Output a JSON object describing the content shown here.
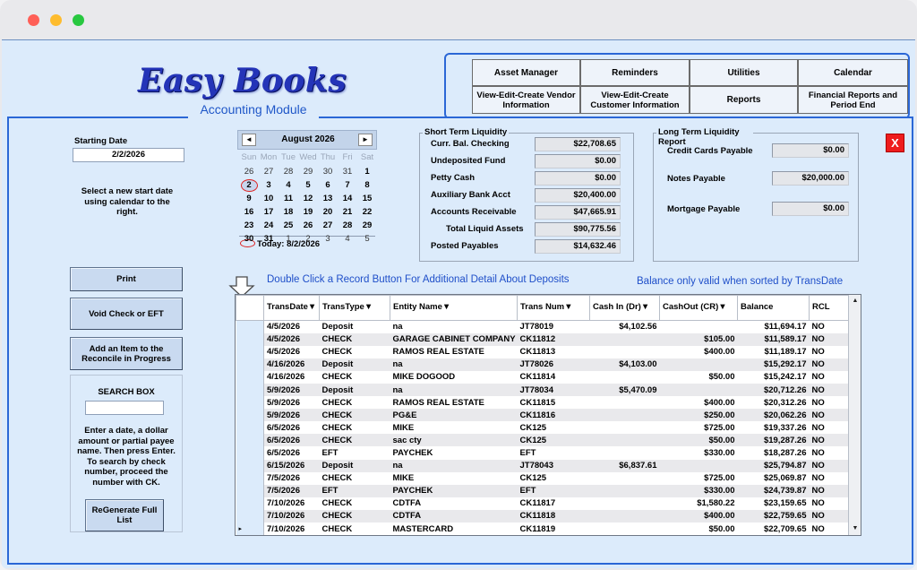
{
  "app": {
    "logo": "Easy Books",
    "module_title": "Accounting Module",
    "close_label": "X"
  },
  "nav": {
    "items": [
      {
        "label": "Asset Manager"
      },
      {
        "label": "Reminders"
      },
      {
        "label": "Utilities"
      },
      {
        "label": "Calendar"
      },
      {
        "label": "View-Edit-Create Vendor Information"
      },
      {
        "label": "View-Edit-Create Customer Information"
      },
      {
        "label": "Reports"
      },
      {
        "label": "Financial Reports and Period End"
      }
    ]
  },
  "start": {
    "label": "Starting Date",
    "value": "2/2/2026",
    "hint": "Select a new start date using calendar to the right."
  },
  "calendar": {
    "month": "August 2026",
    "prev_icon": "◄",
    "next_icon": "►",
    "weekdays": [
      "Sun",
      "Mon",
      "Tue",
      "Wed",
      "Thu",
      "Fri",
      "Sat"
    ],
    "days": [
      {
        "d": "26",
        "m": true
      },
      {
        "d": "27",
        "m": true
      },
      {
        "d": "28",
        "m": true
      },
      {
        "d": "29",
        "m": true
      },
      {
        "d": "30",
        "m": true
      },
      {
        "d": "31",
        "m": true
      },
      {
        "d": "1"
      },
      {
        "d": "2",
        "sel": true
      },
      {
        "d": "3"
      },
      {
        "d": "4"
      },
      {
        "d": "5"
      },
      {
        "d": "6"
      },
      {
        "d": "7"
      },
      {
        "d": "8"
      },
      {
        "d": "9"
      },
      {
        "d": "10"
      },
      {
        "d": "11"
      },
      {
        "d": "12"
      },
      {
        "d": "13"
      },
      {
        "d": "14"
      },
      {
        "d": "15"
      },
      {
        "d": "16"
      },
      {
        "d": "17"
      },
      {
        "d": "18"
      },
      {
        "d": "19"
      },
      {
        "d": "20"
      },
      {
        "d": "21"
      },
      {
        "d": "22"
      },
      {
        "d": "23"
      },
      {
        "d": "24"
      },
      {
        "d": "25"
      },
      {
        "d": "26"
      },
      {
        "d": "27"
      },
      {
        "d": "28"
      },
      {
        "d": "29"
      },
      {
        "d": "30"
      },
      {
        "d": "31"
      },
      {
        "d": "1",
        "m": true
      },
      {
        "d": "2",
        "m": true
      },
      {
        "d": "3",
        "m": true
      },
      {
        "d": "4",
        "m": true
      },
      {
        "d": "5",
        "m": true
      }
    ],
    "today_label": "Today: 8/2/2026"
  },
  "short_term": {
    "title": "Short Term Liquidity",
    "rows": [
      {
        "label": "Curr. Bal. Checking",
        "value": "$22,708.65"
      },
      {
        "label": "Undeposited Fund",
        "value": "$0.00"
      },
      {
        "label": "Petty Cash",
        "value": "$0.00"
      },
      {
        "label": "Auxiliary Bank Acct",
        "value": "$20,400.00"
      },
      {
        "label": "Accounts Receivable",
        "value": "$47,665.91"
      },
      {
        "label": "Total Liquid Assets",
        "value": "$90,775.56"
      },
      {
        "label": "Posted Payables",
        "value": "$14,632.46"
      }
    ]
  },
  "long_term": {
    "title": "Long Term Liquidity Report",
    "rows": [
      {
        "label": "Credit Cards Payable",
        "value": "$0.00"
      },
      {
        "label": "Notes Payable",
        "value": "$20,000.00"
      },
      {
        "label": "Mortgage Payable",
        "value": "$0.00"
      }
    ]
  },
  "buttons": {
    "print": "Print",
    "void": "Void Check or EFT",
    "add_item": "Add an Item to the Reconcile in Progress",
    "regenerate": "ReGenerate Full List"
  },
  "search": {
    "title": "SEARCH BOX",
    "value": "",
    "hint": "Enter a date, a dollar amount or partial payee name. Then press Enter. To search by check number, proceed the number with CK."
  },
  "messages": {
    "double_click": "Double Click a Record Button For Additional Detail About Deposits",
    "balance_note": "Balance only valid when sorted by TransDate"
  },
  "table": {
    "headers": [
      "TransDate▼",
      "TransType▼",
      "Entity Name▼",
      "Trans Num▼",
      "Cash In (Dr)▼",
      "CashOut (CR)▼",
      "Balance",
      "RCL"
    ],
    "rows": [
      [
        "4/5/2026",
        "Deposit",
        "na",
        "JT78019",
        "$4,102.56",
        "",
        "$11,694.17",
        "NO"
      ],
      [
        "4/5/2026",
        "CHECK",
        "GARAGE CABINET COMPANY",
        "CK11812",
        "",
        "$105.00",
        "$11,589.17",
        "NO"
      ],
      [
        "4/5/2026",
        "CHECK",
        "RAMOS REAL ESTATE",
        "CK11813",
        "",
        "$400.00",
        "$11,189.17",
        "NO"
      ],
      [
        "4/16/2026",
        "Deposit",
        "na",
        "JT78026",
        "$4,103.00",
        "",
        "$15,292.17",
        "NO"
      ],
      [
        "4/16/2026",
        "CHECK",
        "MIKE DOGOOD",
        "CK11814",
        "",
        "$50.00",
        "$15,242.17",
        "NO"
      ],
      [
        "5/9/2026",
        "Deposit",
        "na",
        "JT78034",
        "$5,470.09",
        "",
        "$20,712.26",
        "NO"
      ],
      [
        "5/9/2026",
        "CHECK",
        "RAMOS REAL ESTATE",
        "CK11815",
        "",
        "$400.00",
        "$20,312.26",
        "NO"
      ],
      [
        "5/9/2026",
        "CHECK",
        "PG&E",
        "CK11816",
        "",
        "$250.00",
        "$20,062.26",
        "NO"
      ],
      [
        "6/5/2026",
        "CHECK",
        "MIKE",
        "CK125",
        "",
        "$725.00",
        "$19,337.26",
        "NO"
      ],
      [
        "6/5/2026",
        "CHECK",
        "sac cty",
        "CK125",
        "",
        "$50.00",
        "$19,287.26",
        "NO"
      ],
      [
        "6/5/2026",
        "EFT",
        "PAYCHEK",
        "EFT",
        "",
        "$330.00",
        "$18,287.26",
        "NO"
      ],
      [
        "6/15/2026",
        "Deposit",
        "na",
        "JT78043",
        "$6,837.61",
        "",
        "$25,794.87",
        "NO"
      ],
      [
        "7/5/2026",
        "CHECK",
        "MIKE",
        "CK125",
        "",
        "$725.00",
        "$25,069.87",
        "NO"
      ],
      [
        "7/5/2026",
        "EFT",
        "PAYCHEK",
        "EFT",
        "",
        "$330.00",
        "$24,739.87",
        "NO"
      ],
      [
        "7/10/2026",
        "CHECK",
        "CDTFA",
        "CK11817",
        "",
        "$1,580.22",
        "$23,159.65",
        "NO"
      ],
      [
        "7/10/2026",
        "CHECK",
        "CDTFA",
        "CK11818",
        "",
        "$400.00",
        "$22,759.65",
        "NO"
      ],
      [
        "7/10/2026",
        "CHECK",
        "MASTERCARD",
        "CK11819",
        "",
        "$50.00",
        "$22,709.65",
        "NO"
      ]
    ],
    "current_row_marker": "▸",
    "scroll_up_icon": "▲",
    "scroll_down_icon": "▼"
  }
}
